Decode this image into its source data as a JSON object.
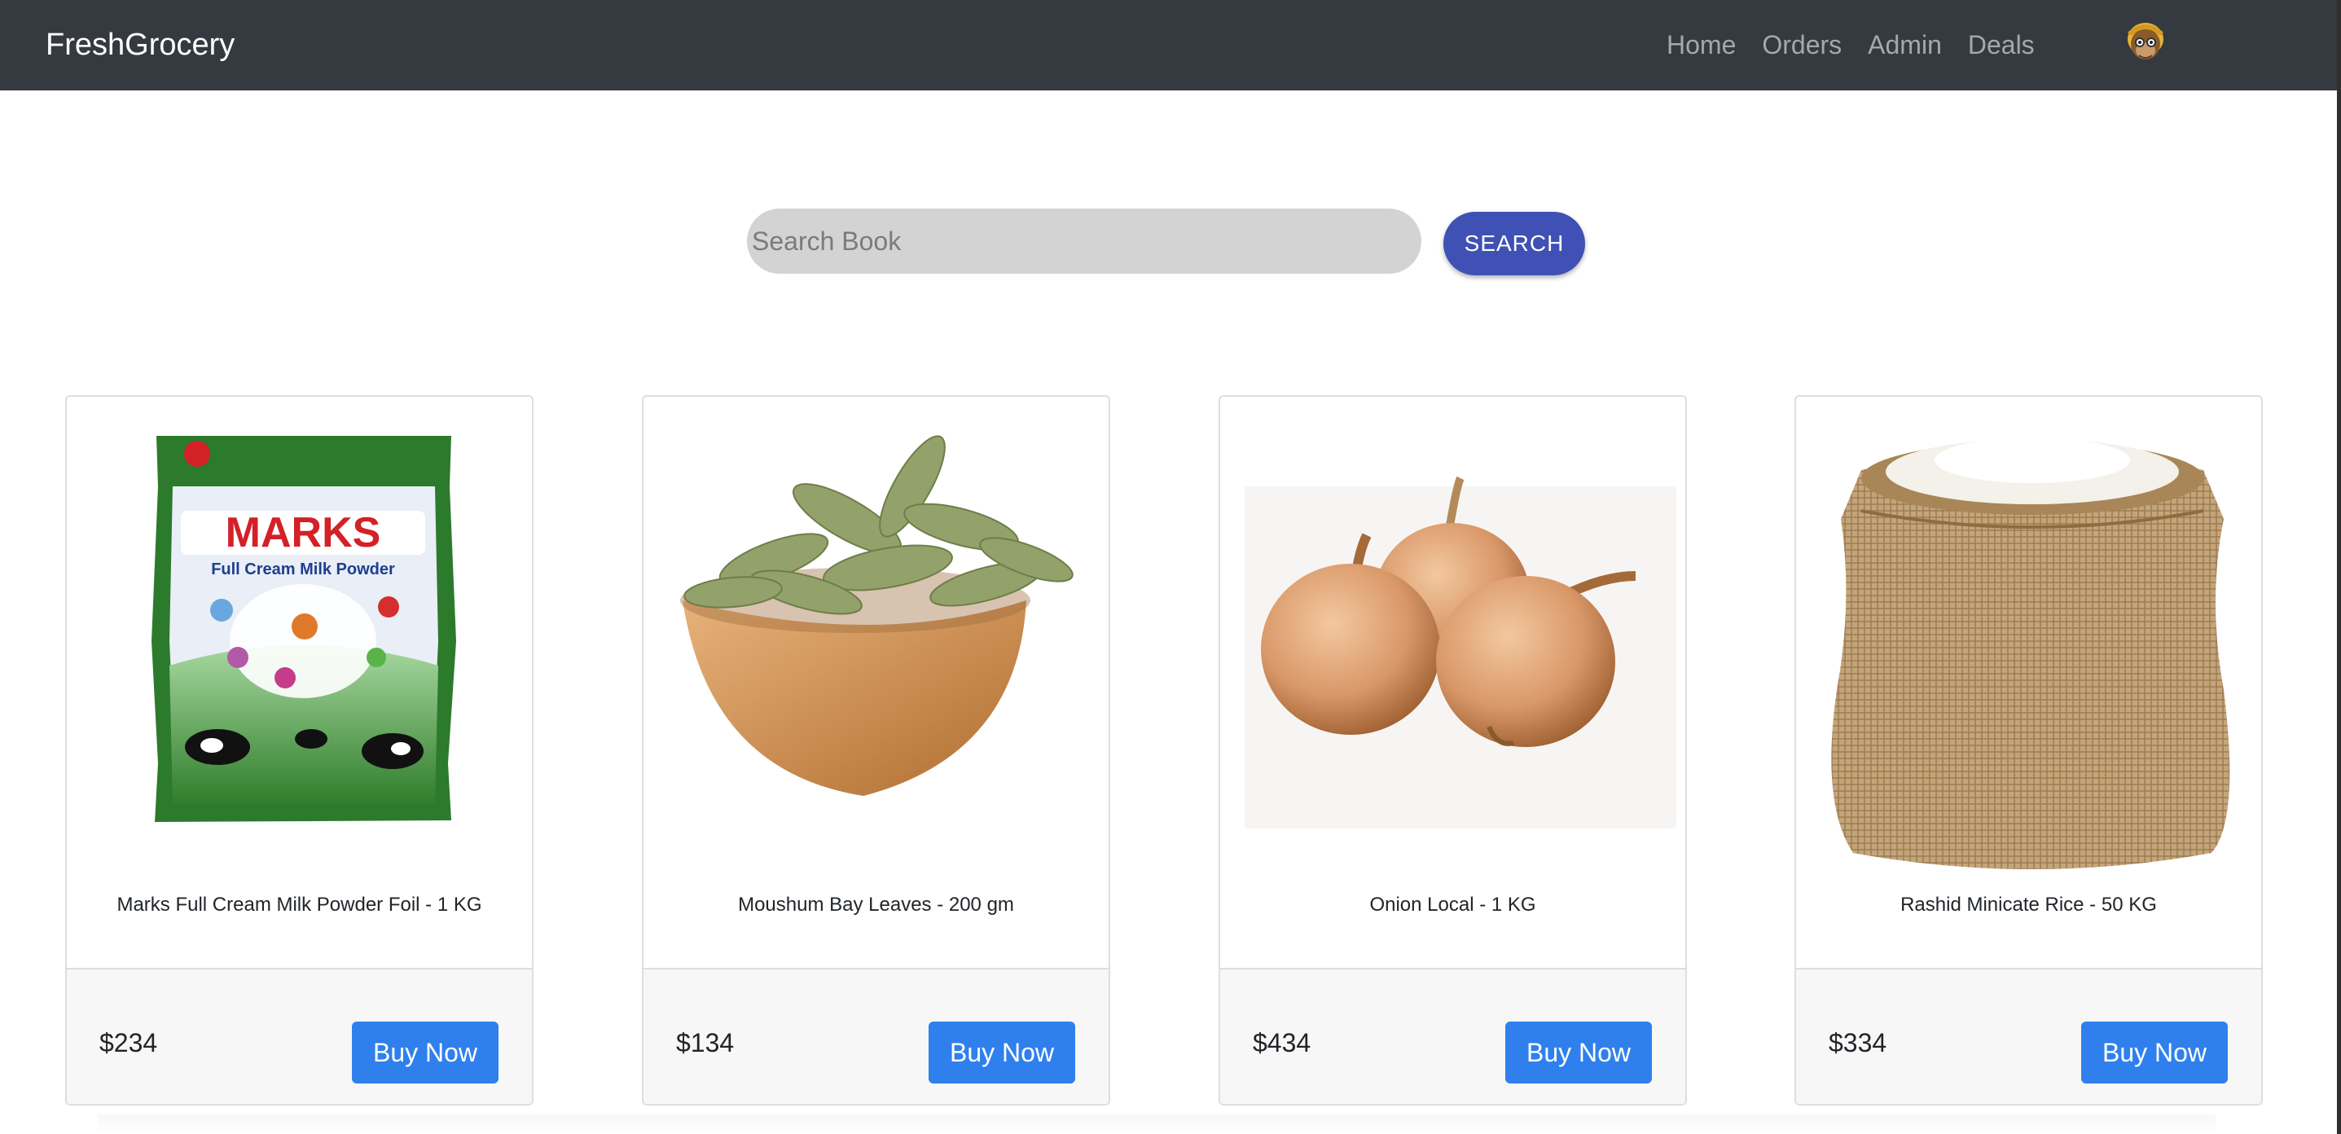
{
  "navbar": {
    "brand": "FreshGrocery",
    "links": [
      "Home",
      "Orders",
      "Admin",
      "Deals"
    ],
    "avatar_icon": "user-avatar-icon"
  },
  "search": {
    "placeholder": "Search Book",
    "value": "",
    "button_label": "SEARCH"
  },
  "products": [
    {
      "title": "Marks Full Cream Milk Powder Foil - 1 KG",
      "price": "$234",
      "button": "Buy Now",
      "image_icon": "milk-powder-bag-image"
    },
    {
      "title": "Moushum Bay Leaves - 200 gm",
      "price": "$134",
      "button": "Buy Now",
      "image_icon": "bay-leaves-bowl-image"
    },
    {
      "title": "Onion Local - 1 KG",
      "price": "$434",
      "button": "Buy Now",
      "image_icon": "onions-image"
    },
    {
      "title": "Rashid Minicate Rice - 50 KG",
      "price": "$334",
      "button": "Buy Now",
      "image_icon": "rice-sack-image"
    }
  ],
  "product_packaging_text": {
    "brand_mark": "MARKS",
    "subtitle": "Full Cream Milk Powder"
  },
  "colors": {
    "navbar": "#343a40",
    "search_button": "#3f51b5",
    "buy_button": "#2f80ed",
    "search_field": "#d3d3d3"
  }
}
